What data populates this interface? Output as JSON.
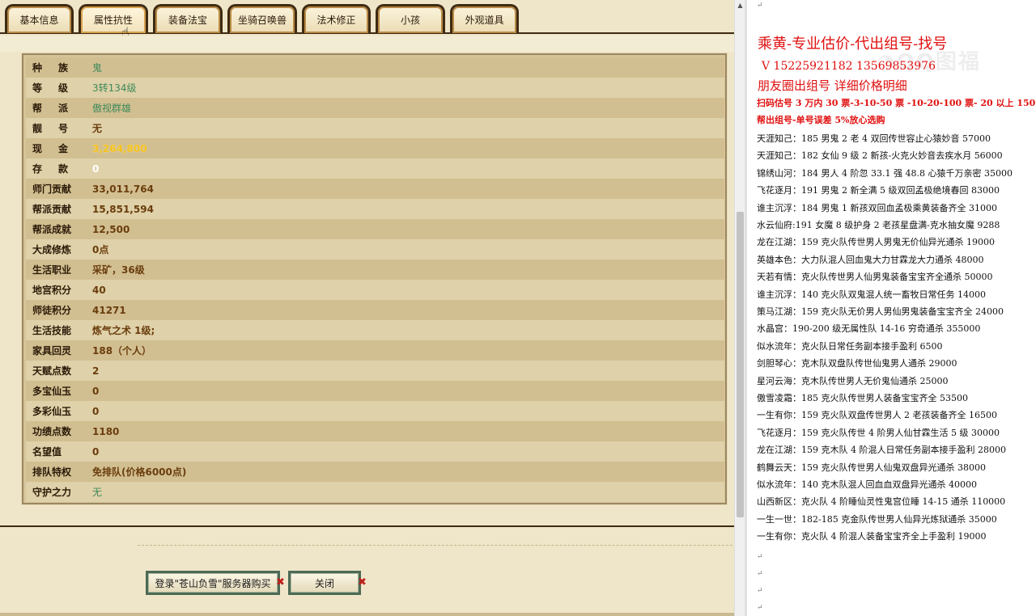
{
  "tabs": [
    {
      "label": "基本信息",
      "active": false
    },
    {
      "label": "属性抗性",
      "active": true
    },
    {
      "label": "装备法宝",
      "active": false
    },
    {
      "label": "坐骑召唤兽",
      "active": false
    },
    {
      "label": "法术修正",
      "active": false
    },
    {
      "label": "小孩",
      "active": false
    },
    {
      "label": "外观道具",
      "active": false
    }
  ],
  "info_rows": [
    {
      "label": "种族",
      "value": "鬼",
      "style": "green",
      "spaced": true
    },
    {
      "label": "等级",
      "value": "3转134级",
      "style": "green",
      "spaced": true
    },
    {
      "label": "帮派",
      "value": "傲视群雄",
      "style": "green",
      "spaced": true
    },
    {
      "label": "靓号",
      "value": "无",
      "style": "normal",
      "spaced": true
    },
    {
      "label": "现金",
      "value": "3,264,800",
      "style": "gold",
      "spaced": true
    },
    {
      "label": "存款",
      "value": "0",
      "style": "white",
      "spaced": true
    },
    {
      "label": "师门贡献",
      "value": "33,011,764",
      "style": "normal",
      "spaced": false
    },
    {
      "label": "帮派贡献",
      "value": "15,851,594",
      "style": "normal",
      "spaced": false
    },
    {
      "label": "帮派成就",
      "value": "12,500",
      "style": "normal",
      "spaced": false
    },
    {
      "label": "大成修炼",
      "value": "0点",
      "style": "normal",
      "spaced": false
    },
    {
      "label": "生活职业",
      "value": "采矿，36级",
      "style": "normal",
      "spaced": false
    },
    {
      "label": "地宫积分",
      "value": "40",
      "style": "normal",
      "spaced": false
    },
    {
      "label": "师徒积分",
      "value": "41271",
      "style": "normal",
      "spaced": false
    },
    {
      "label": "生活技能",
      "value": "炼气之术 1级;",
      "style": "normal",
      "spaced": false
    },
    {
      "label": "家具回灵",
      "value": "188（个人）",
      "style": "normal",
      "spaced": false
    },
    {
      "label": "天赋点数",
      "value": "2",
      "style": "normal",
      "spaced": false
    },
    {
      "label": "多宝仙玉",
      "value": "0",
      "style": "normal",
      "spaced": false
    },
    {
      "label": "多彩仙玉",
      "value": "0",
      "style": "normal",
      "spaced": false
    },
    {
      "label": "功绩点数",
      "value": "1180",
      "style": "normal",
      "spaced": false
    },
    {
      "label": "名望值",
      "value": "0",
      "style": "normal",
      "spaced": false
    },
    {
      "label": "排队特权",
      "value": "免排队(价格6000点)",
      "style": "normal",
      "spaced": false
    },
    {
      "label": "守护之力",
      "value": "无",
      "style": "green",
      "spaced": false
    }
  ],
  "buttons": {
    "login_buy": "登录\"苍山负雪\"服务器购买",
    "close": "关闭"
  },
  "doc": {
    "title": "乘黄-专业估价-代出组号-找号",
    "phone": "V 15225921182   13569853976",
    "subtitle": "朋友圈出组号   详细价格明细",
    "price_line1": "扫码估号 3 万内 30 票-3-10-50 票  -10-20-100 票- 20 以上 150",
    "price_line2": "帮出组号-单号误差 5%放心选购",
    "listings": [
      "天涯知己：185 男鬼 2 老 4 双回传世容止心猿妙音 57000",
      "天涯知己：182 女仙 9 级 2 新孩-火克火妙音去疾水月 56000",
      "锦绣山河：184 男人 4 阶忽 33.1 强 48.8 心猿千万亲密 35000",
      "飞花逐月：191 男鬼 2 新全满 5 级双回孟极绝境春回 83000",
      "谁主沉浮：184 男鬼 1 新孩双回血孟极乘黄装备齐全 31000",
      "水云仙府:191 女魔 8 级护身 2 老孩星盘满-克水抽女魔 9288",
      "龙在江湖：159 克火队传世男人男鬼无价仙异光通杀 19000",
      "英雄本色：大力队混人回血鬼大力甘霖龙大力通杀 48000",
      "天若有情：克火队传世男人仙男鬼装备宝宝齐全通杀 50000",
      "谁主沉浮：140 克火队双鬼混人统一畜牧日常任务 14000",
      "策马江湖：159 克火队无价男人男仙男鬼装备宝宝齐全 24000",
      "水晶宫：190-200 级无属性队 14-16 穷奇通杀 355000",
      "似水流年：克火队日常任务副本接手盈利 6500",
      "剑胆琴心：克木队双盘队传世仙鬼男人通杀 29000",
      "星河云海：克木队传世男人无价鬼仙通杀 25000",
      "傲雪凌霜：185 克火队传世男人装备宝宝齐全 53500",
      "一生有你：159 克火队双盘传世男人 2 老孩装备齐全 16500",
      "飞花逐月：159 克火队传世 4 阶男人仙甘霖生活 5 级 30000",
      "龙在江湖：159 克木队 4 阶混人日常任务副本接手盈利 28000",
      "鹤舞云天：159 克火队传世男人仙鬼双盘异光通杀 38000",
      "似水流年：140 克木队混人回血血双盘异光通杀 40000",
      "山西新区：克火队 4 阶睡仙灵性鬼宫位睡 14-15 通杀 110000",
      "一生一世：182-185 克金队传世男人仙异光炼狱通杀 35000",
      "一生有你：克火队 4 阶混人装备宝宝齐全上手盈利 19000"
    ]
  }
}
